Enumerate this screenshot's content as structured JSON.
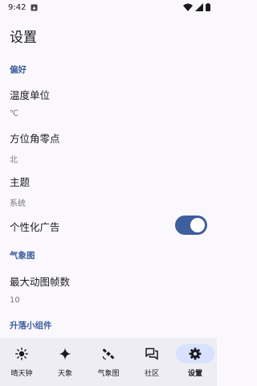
{
  "status_bar": {
    "time": "9:42"
  },
  "page": {
    "title": "设置"
  },
  "sections": {
    "preferences": "偏好",
    "weather_map": "气象图",
    "rise_set_widget": "升落小组件"
  },
  "settings": {
    "temperature_unit": {
      "title": "温度单位",
      "value": "℃"
    },
    "compass_zero": {
      "title": "方位角零点",
      "value": "北"
    },
    "theme": {
      "title": "主题",
      "value": "系统"
    },
    "personalized_ads": {
      "title": "个性化广告",
      "enabled": true
    },
    "max_animation_frames": {
      "title": "最大动图帧数",
      "value": "10"
    }
  },
  "nav": {
    "items": [
      {
        "label": "晴天钟",
        "icon": "sun-icon"
      },
      {
        "label": "天象",
        "icon": "sparkle-icon"
      },
      {
        "label": "气象图",
        "icon": "satellite-icon"
      },
      {
        "label": "社区",
        "icon": "forum-icon"
      },
      {
        "label": "设置",
        "icon": "gear-icon",
        "active": true
      }
    ]
  },
  "colors": {
    "accent": "#3e5e9e",
    "background": "#fbf8fd",
    "nav_background": "#eeedf4",
    "active_pill": "#d8e2ff"
  }
}
